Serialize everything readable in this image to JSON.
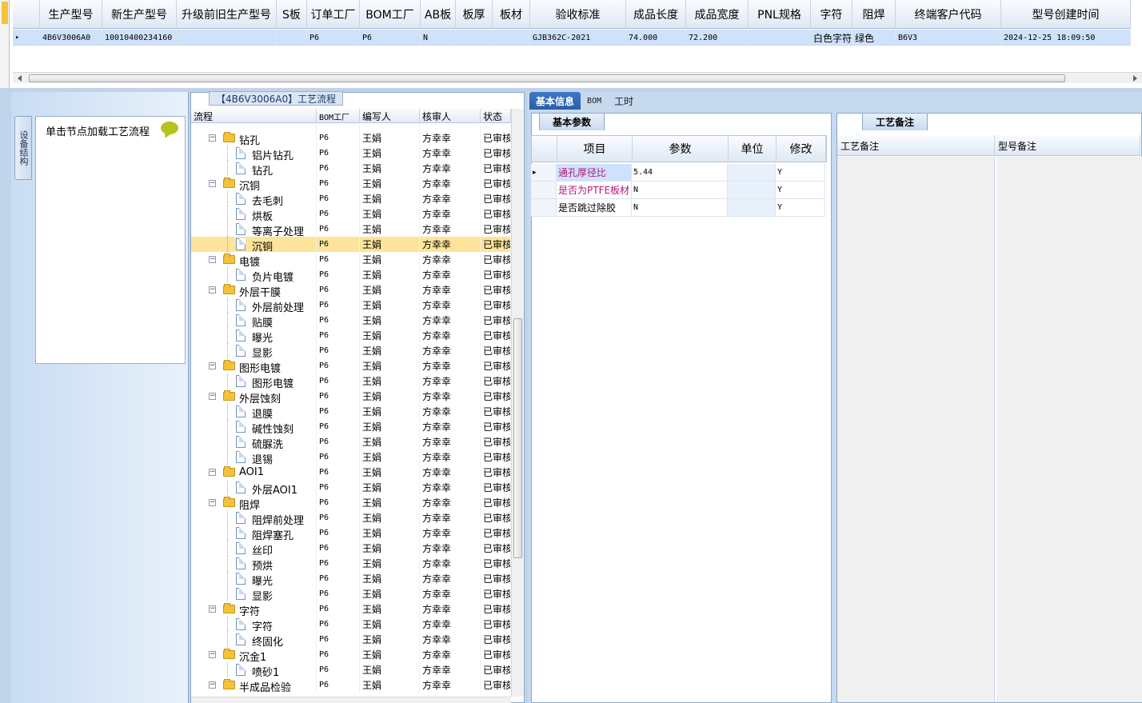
{
  "top_grid": {
    "columns": [
      "生产型号",
      "新生产型号",
      "升级前旧生产型号",
      "S板",
      "订单工厂",
      "BOM工厂",
      "AB板",
      "板厚",
      "板材",
      "验收标准",
      "成品长度",
      "成品宽度",
      "PNL规格",
      "字符",
      "阻焊",
      "终端客户代码",
      "型号创建时间"
    ],
    "row": [
      "4B6V3006A0",
      "10010400234160",
      "",
      "",
      "P6",
      "P6",
      "N",
      "",
      "",
      "GJB362C-2021",
      "74.000",
      "72.200",
      "",
      "白色字符",
      "绿色",
      "B6V3",
      "2024-12-25 18:09:50"
    ]
  },
  "left_panel": {
    "vertical_tab": "设备结构",
    "hint_text": "单击节点加载工艺流程"
  },
  "process_tree": {
    "title": "【4B6V3006A0】工艺流程",
    "columns": [
      "流程",
      "BOM工厂",
      "编写人",
      "核审人",
      "状态"
    ],
    "rows": [
      {
        "level": 1,
        "type": "folder",
        "name": "钻孔",
        "bom": "P6",
        "writer": "王娟",
        "reviewer": "方幸幸",
        "status": "已审核"
      },
      {
        "level": 2,
        "type": "doc",
        "name": "铝片钻孔",
        "bom": "P6",
        "writer": "王娟",
        "reviewer": "方幸幸",
        "status": "已审核"
      },
      {
        "level": 2,
        "type": "doc",
        "name": "钻孔",
        "bom": "P6",
        "writer": "王娟",
        "reviewer": "方幸幸",
        "status": "已审核"
      },
      {
        "level": 1,
        "type": "folder",
        "name": "沉铜",
        "bom": "P6",
        "writer": "王娟",
        "reviewer": "方幸幸",
        "status": "已审核"
      },
      {
        "level": 2,
        "type": "doc",
        "name": "去毛刺",
        "bom": "P6",
        "writer": "王娟",
        "reviewer": "方幸幸",
        "status": "已审核"
      },
      {
        "level": 2,
        "type": "doc",
        "name": "烘板",
        "bom": "P6",
        "writer": "王娟",
        "reviewer": "方幸幸",
        "status": "已审核"
      },
      {
        "level": 2,
        "type": "doc",
        "name": "等离子处理",
        "bom": "P6",
        "writer": "王娟",
        "reviewer": "方幸幸",
        "status": "已审核"
      },
      {
        "level": 2,
        "type": "doc",
        "name": "沉铜",
        "bom": "P6",
        "writer": "王娟",
        "reviewer": "方幸幸",
        "status": "已审核",
        "selected": true
      },
      {
        "level": 1,
        "type": "folder",
        "name": "电镀",
        "bom": "P6",
        "writer": "王娟",
        "reviewer": "方幸幸",
        "status": "已审核"
      },
      {
        "level": 2,
        "type": "doc",
        "name": "负片电镀",
        "bom": "P6",
        "writer": "王娟",
        "reviewer": "方幸幸",
        "status": "已审核"
      },
      {
        "level": 1,
        "type": "folder",
        "name": "外层干膜",
        "bom": "P6",
        "writer": "王娟",
        "reviewer": "方幸幸",
        "status": "已审核"
      },
      {
        "level": 2,
        "type": "doc",
        "name": "外层前处理",
        "bom": "P6",
        "writer": "王娟",
        "reviewer": "方幸幸",
        "status": "已审核"
      },
      {
        "level": 2,
        "type": "doc",
        "name": "贴膜",
        "bom": "P6",
        "writer": "王娟",
        "reviewer": "方幸幸",
        "status": "已审核"
      },
      {
        "level": 2,
        "type": "doc",
        "name": "曝光",
        "bom": "P6",
        "writer": "王娟",
        "reviewer": "方幸幸",
        "status": "已审核"
      },
      {
        "level": 2,
        "type": "doc",
        "name": "显影",
        "bom": "P6",
        "writer": "王娟",
        "reviewer": "方幸幸",
        "status": "已审核"
      },
      {
        "level": 1,
        "type": "folder",
        "name": "图形电镀",
        "bom": "P6",
        "writer": "王娟",
        "reviewer": "方幸幸",
        "status": "已审核"
      },
      {
        "level": 2,
        "type": "doc",
        "name": "图形电镀",
        "bom": "P6",
        "writer": "王娟",
        "reviewer": "方幸幸",
        "status": "已审核"
      },
      {
        "level": 1,
        "type": "folder",
        "name": "外层蚀刻",
        "bom": "P6",
        "writer": "王娟",
        "reviewer": "方幸幸",
        "status": "已审核"
      },
      {
        "level": 2,
        "type": "doc",
        "name": "退膜",
        "bom": "P6",
        "writer": "王娟",
        "reviewer": "方幸幸",
        "status": "已审核"
      },
      {
        "level": 2,
        "type": "doc",
        "name": "碱性蚀刻",
        "bom": "P6",
        "writer": "王娟",
        "reviewer": "方幸幸",
        "status": "已审核"
      },
      {
        "level": 2,
        "type": "doc",
        "name": "硫脲洗",
        "bom": "P6",
        "writer": "王娟",
        "reviewer": "方幸幸",
        "status": "已审核"
      },
      {
        "level": 2,
        "type": "doc",
        "name": "退锡",
        "bom": "P6",
        "writer": "王娟",
        "reviewer": "方幸幸",
        "status": "已审核"
      },
      {
        "level": 1,
        "type": "folder",
        "name": "AOI1",
        "bom": "P6",
        "writer": "王娟",
        "reviewer": "方幸幸",
        "status": "已审核"
      },
      {
        "level": 2,
        "type": "doc",
        "name": "外层AOI1",
        "bom": "P6",
        "writer": "王娟",
        "reviewer": "方幸幸",
        "status": "已审核"
      },
      {
        "level": 1,
        "type": "folder",
        "name": "阻焊",
        "bom": "P6",
        "writer": "王娟",
        "reviewer": "方幸幸",
        "status": "已审核"
      },
      {
        "level": 2,
        "type": "doc",
        "name": "阻焊前处理",
        "bom": "P6",
        "writer": "王娟",
        "reviewer": "方幸幸",
        "status": "已审核"
      },
      {
        "level": 2,
        "type": "doc",
        "name": "阻焊塞孔",
        "bom": "P6",
        "writer": "王娟",
        "reviewer": "方幸幸",
        "status": "已审核"
      },
      {
        "level": 2,
        "type": "doc",
        "name": "丝印",
        "bom": "P6",
        "writer": "王娟",
        "reviewer": "方幸幸",
        "status": "已审核"
      },
      {
        "level": 2,
        "type": "doc",
        "name": "预烘",
        "bom": "P6",
        "writer": "王娟",
        "reviewer": "方幸幸",
        "status": "已审核"
      },
      {
        "level": 2,
        "type": "doc",
        "name": "曝光",
        "bom": "P6",
        "writer": "王娟",
        "reviewer": "方幸幸",
        "status": "已审核"
      },
      {
        "level": 2,
        "type": "doc",
        "name": "显影",
        "bom": "P6",
        "writer": "王娟",
        "reviewer": "方幸幸",
        "status": "已审核"
      },
      {
        "level": 1,
        "type": "folder",
        "name": "字符",
        "bom": "P6",
        "writer": "王娟",
        "reviewer": "方幸幸",
        "status": "已审核"
      },
      {
        "level": 2,
        "type": "doc",
        "name": "字符",
        "bom": "P6",
        "writer": "王娟",
        "reviewer": "方幸幸",
        "status": "已审核"
      },
      {
        "level": 2,
        "type": "doc",
        "name": "终固化",
        "bom": "P6",
        "writer": "王娟",
        "reviewer": "方幸幸",
        "status": "已审核"
      },
      {
        "level": 1,
        "type": "folder",
        "name": "沉金1",
        "bom": "P6",
        "writer": "王娟",
        "reviewer": "方幸幸",
        "status": "已审核"
      },
      {
        "level": 2,
        "type": "doc",
        "name": "喷砂1",
        "bom": "P6",
        "writer": "王娟",
        "reviewer": "方幸幸",
        "status": "已审核"
      },
      {
        "level": 1,
        "type": "folder",
        "name": "半成品检验",
        "bom": "P6",
        "writer": "王娟",
        "reviewer": "方幸幸",
        "status": "已审核"
      }
    ]
  },
  "detail_tabs": [
    "基本信息",
    "BOM",
    "工时"
  ],
  "basic_params": {
    "tab": "基本参数",
    "columns": [
      "项目",
      "参数",
      "单位",
      "修改"
    ],
    "rows": [
      {
        "item": "通孔厚径比",
        "value": "5.44",
        "unit": "",
        "edit": "Y",
        "highlight": true
      },
      {
        "item": "是否为PTFE板材",
        "value": "N",
        "unit": "",
        "edit": "Y",
        "highlight": true
      },
      {
        "item": "是否跳过除胶",
        "value": "N",
        "unit": "",
        "edit": "Y",
        "highlight": false
      }
    ]
  },
  "notes": {
    "tab": "工艺备注",
    "columns": [
      "工艺备注",
      "型号备注"
    ]
  }
}
